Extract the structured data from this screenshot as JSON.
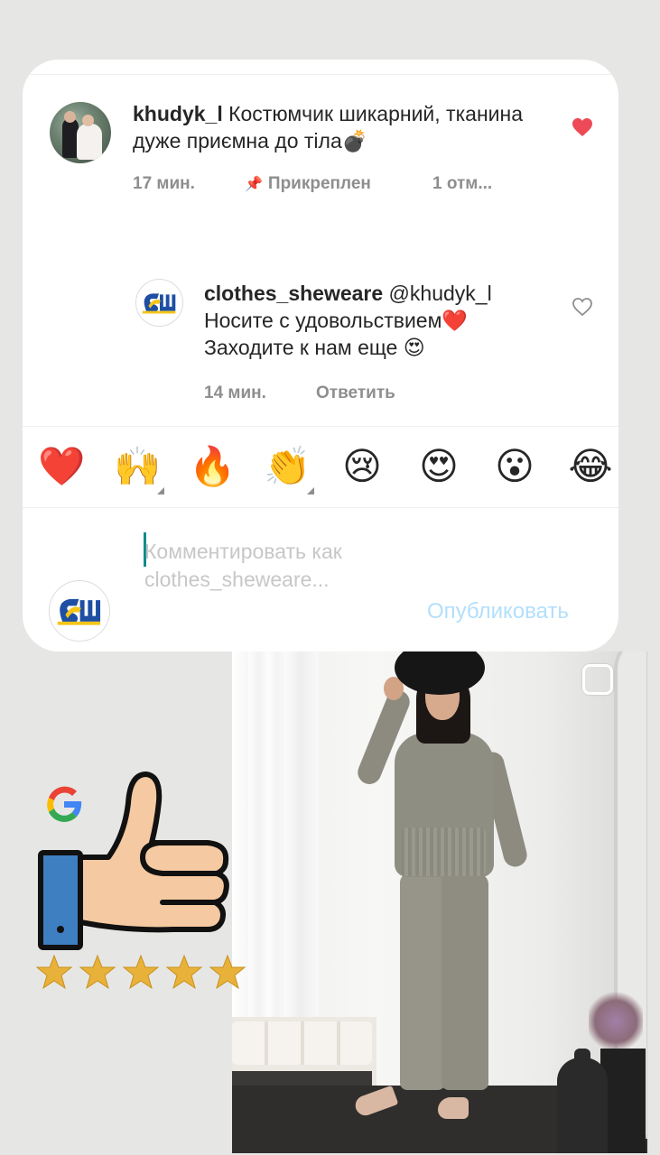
{
  "comment": {
    "username": "khudyk_l",
    "text": " Костюмчик шикарний, тканина дуже приємна до тіла💣",
    "time": "17 мин.",
    "pinned_label": "Прикреплен",
    "likes_label": "1 отм..."
  },
  "reply": {
    "username": "clothes_sheweare",
    "mention": " @khudyk_l",
    "line1": "Носите с удовольствием❤️",
    "line2": "Заходите к нам еще 😍",
    "time": "14 мин.",
    "reply_label": "Ответить"
  },
  "reactions": [
    "❤️",
    "🙌",
    "🔥",
    "👏",
    "😢",
    "😍",
    "😮",
    "😂"
  ],
  "composer": {
    "placeholder": "Комментировать как clothes_sheweare...",
    "publish_label": "Опубликовать"
  },
  "colors": {
    "like_red": "#ed4956",
    "publish_blue_disabled": "#b2dffc",
    "meta_gray": "#8e8e8e",
    "brand_blue": "#1e4fa3",
    "brand_yellow": "#f5c518"
  },
  "rating": {
    "stars": 5,
    "max": 5
  }
}
